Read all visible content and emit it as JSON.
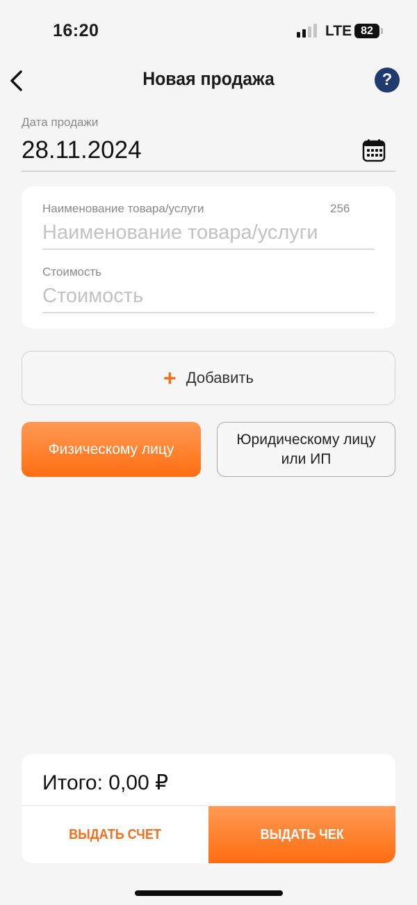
{
  "status_bar": {
    "time": "16:20",
    "network": "LTE",
    "battery": "82"
  },
  "nav": {
    "title": "Новая продажа",
    "help_label": "?"
  },
  "sale_date": {
    "label": "Дата продажи",
    "value": "28.11.2024"
  },
  "item": {
    "name_label": "Наименование товара/услуги",
    "name_counter": "256",
    "name_placeholder": "Наименование товара/услуги",
    "name_value": "",
    "price_label": "Стоимость",
    "price_placeholder": "Стоимость",
    "price_value": ""
  },
  "add_button": {
    "icon": "plus-icon",
    "label": "Добавить"
  },
  "client_type": {
    "individual_label": "Физическому лицу",
    "legal_label": "Юридическому лицу или ИП",
    "selected": "individual"
  },
  "summary": {
    "total": "Итого: 0,00 ₽",
    "invoice_label": "ВЫДАТЬ СЧЕТ",
    "receipt_label": "ВЫДАТЬ ЧЕК"
  },
  "colors": {
    "accent": "#ff6d10",
    "help_button": "#1e3a6e",
    "background": "#f5f5f5"
  }
}
